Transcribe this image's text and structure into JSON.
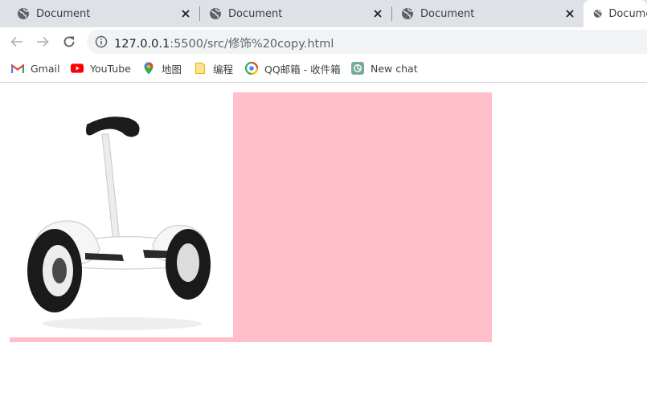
{
  "tabs": [
    {
      "title": "Document",
      "active": false
    },
    {
      "title": "Document",
      "active": false
    },
    {
      "title": "Document",
      "active": false
    },
    {
      "title": "Document",
      "active": true
    }
  ],
  "address": {
    "host": "127.0.0.1",
    "path": ":5500/src/修饰%20copy.html"
  },
  "bookmarks": [
    {
      "label": "Gmail",
      "icon": "gmail-icon"
    },
    {
      "label": "YouTube",
      "icon": "youtube-icon"
    },
    {
      "label": "地图",
      "icon": "maps-pin-icon"
    },
    {
      "label": "编程",
      "icon": "folder-icon"
    },
    {
      "label": "QQ邮箱 - 收件箱",
      "icon": "qq-mail-icon"
    },
    {
      "label": "New chat",
      "icon": "chatgpt-icon"
    }
  ],
  "page": {
    "box_color": "#ffc0cb",
    "image_subject": "self-balancing scooter"
  }
}
